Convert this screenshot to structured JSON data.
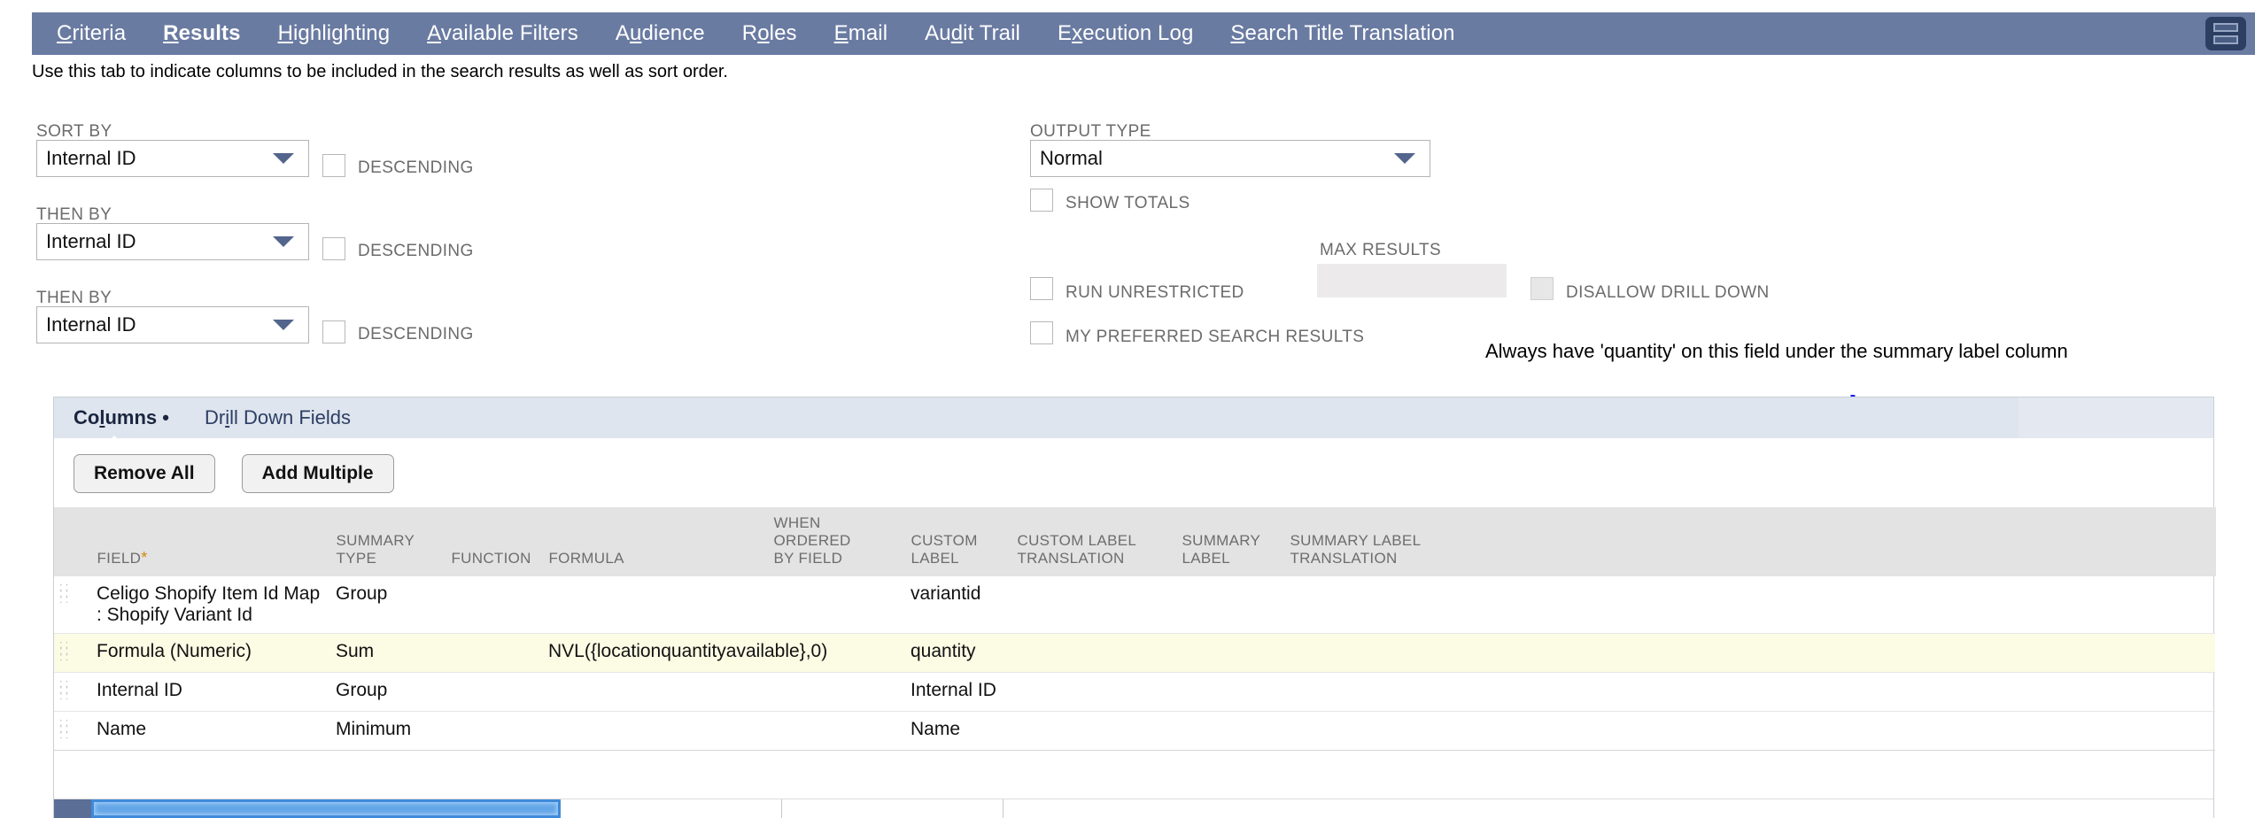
{
  "top_tabs": [
    {
      "label": "Criteria",
      "accel": "C",
      "active": false
    },
    {
      "label": "Results",
      "accel": "R",
      "active": true
    },
    {
      "label": "Highlighting",
      "accel": "H",
      "active": false
    },
    {
      "label": "Available Filters",
      "accel": "A",
      "active": false
    },
    {
      "label": "Audience",
      "accel": "u",
      "active": false
    },
    {
      "label": "Roles",
      "accel": "o",
      "active": false
    },
    {
      "label": "Email",
      "accel": "E",
      "active": false
    },
    {
      "label": "Audit Trail",
      "accel": "d",
      "active": false
    },
    {
      "label": "Execution Log",
      "accel": "x",
      "active": false
    },
    {
      "label": "Search Title Translation",
      "accel": "S",
      "active": false
    }
  ],
  "menu_icon": "hamburger-icon",
  "helper_text": "Use this tab to indicate columns to be included in the search results as well as sort order.",
  "sort": {
    "sort_by_label": "SORT BY",
    "then_by_label_1": "THEN BY",
    "then_by_label_2": "THEN BY",
    "sort_by_value": "Internal ID",
    "then_by_value_1": "Internal ID",
    "then_by_value_2": "Internal ID",
    "descending_label_1": "DESCENDING",
    "descending_label_2": "DESCENDING",
    "descending_label_3": "DESCENDING",
    "descending_checked_1": false,
    "descending_checked_2": false,
    "descending_checked_3": false
  },
  "output": {
    "output_type_label": "OUTPUT TYPE",
    "output_type_value": "Normal",
    "show_totals_label": "SHOW TOTALS",
    "show_totals_checked": false,
    "max_results_label": "MAX RESULTS",
    "max_results_value": "",
    "run_unrestricted_label": "RUN UNRESTRICTED",
    "run_unrestricted_checked": false,
    "disallow_drill_down_label": "DISALLOW DRILL DOWN",
    "disallow_drill_down_checked": false,
    "my_preferred_label": "MY PREFERRED SEARCH RESULTS",
    "my_preferred_checked": false
  },
  "annotation": {
    "text": "Always have 'quantity' on this field under the summary label column",
    "arrow_color": "#1a1af0"
  },
  "panel": {
    "subtabs": [
      {
        "label": "Columns",
        "accel": "l",
        "active": true,
        "bullet": "•"
      },
      {
        "label": "Drill Down Fields",
        "accel": "i",
        "active": false,
        "bullet": ""
      }
    ],
    "buttons": [
      {
        "label": "Remove All",
        "name": "remove-all-button"
      },
      {
        "label": "Add Multiple",
        "name": "add-multiple-button"
      }
    ],
    "table": {
      "headers": [
        {
          "l1": "FIELD",
          "l2": "",
          "required": true
        },
        {
          "l1": "SUMMARY",
          "l2": "TYPE",
          "required": false
        },
        {
          "l1": "",
          "l2": "FUNCTION",
          "required": false
        },
        {
          "l1": "",
          "l2": "FORMULA",
          "required": false
        },
        {
          "l1": "WHEN ORDERED",
          "l2": "BY FIELD",
          "required": false
        },
        {
          "l1": "CUSTOM",
          "l2": "LABEL",
          "required": false
        },
        {
          "l1": "CUSTOM LABEL",
          "l2": "TRANSLATION",
          "required": false
        },
        {
          "l1": "SUMMARY",
          "l2": "LABEL",
          "required": false
        },
        {
          "l1": "SUMMARY LABEL",
          "l2": "TRANSLATION",
          "required": false
        }
      ],
      "rows": [
        {
          "field": "Celigo Shopify Item Id Map : Shopify Variant Id",
          "summary_type": "Group",
          "function": "",
          "formula": "",
          "when_ordered_by_field": "",
          "custom_label": "variantid",
          "custom_label_translation": "",
          "summary_label": "",
          "summary_label_translation": "",
          "highlighted": false
        },
        {
          "field": "Formula (Numeric)",
          "summary_type": "Sum",
          "function": "",
          "formula": "NVL({locationquantityavailable},0)",
          "when_ordered_by_field": "",
          "custom_label": "quantity",
          "custom_label_translation": "",
          "summary_label": "",
          "summary_label_translation": "",
          "highlighted": true
        },
        {
          "field": "Internal ID",
          "summary_type": "Group",
          "function": "",
          "formula": "",
          "when_ordered_by_field": "",
          "custom_label": "Internal ID",
          "custom_label_translation": "",
          "summary_label": "",
          "summary_label_translation": "",
          "highlighted": false
        },
        {
          "field": "Name",
          "summary_type": "Minimum",
          "function": "",
          "formula": "",
          "when_ordered_by_field": "",
          "custom_label": "Name",
          "custom_label_translation": "",
          "summary_label": "",
          "summary_label_translation": "",
          "highlighted": false
        }
      ]
    }
  },
  "colors": {
    "tabbar": "#6a7ba2",
    "subtabbar": "#dfe5ee",
    "row_highlight": "#fcfbe4",
    "header": "#e3e3e3",
    "required_star": "#d4870d",
    "selection_blue": "#63a6e8"
  }
}
